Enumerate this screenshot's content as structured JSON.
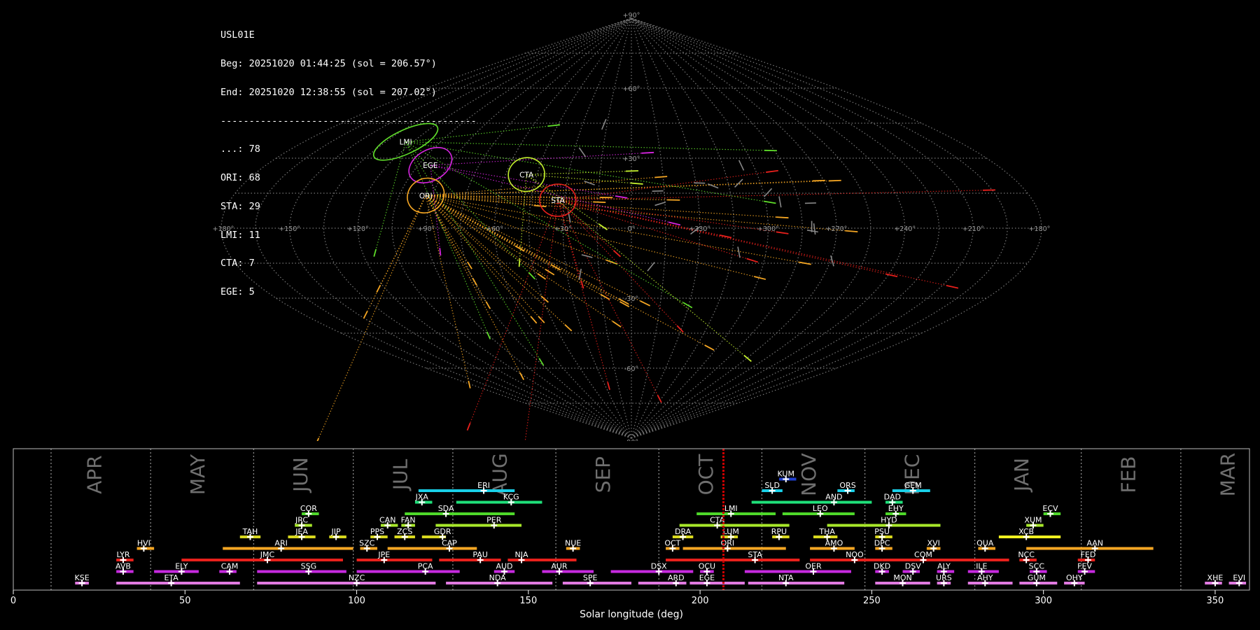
{
  "header": {
    "station": "USL01E",
    "begin": "Beg: 20251020 01:44:25 (sol = 206.57°)",
    "end": "End: 20251020 12:38:55 (sol = 207.02°)",
    "separator": "---------------------------------------------",
    "counts": [
      "...: 78",
      "ORI: 68",
      "STA: 29",
      "LMI: 11",
      "CTA: 7",
      "EGE: 5"
    ]
  },
  "colors": {
    "ORI": "#f5a623",
    "STA": "#e8201c",
    "LMI": "#5fdd2a",
    "EGE": "#d624e0",
    "CTA": "#c4f02e",
    "sporadic": "#888888",
    "grid": "#777777",
    "solarlon": "#cc0000"
  },
  "sky_map": {
    "projection": "sinusoidal (equal-area)",
    "meridian_labels": [
      "+180°",
      "+150°",
      "+120°",
      "+90°",
      "+60°",
      "+30°",
      "0°",
      "+330°",
      "+300°",
      "+270°",
      "+240°",
      "+210°",
      "+180°"
    ],
    "parallel_labels": [
      "+90°",
      "+60°",
      "+30°",
      "-30°",
      "-60°",
      "-90°"
    ],
    "radiants": [
      {
        "code": "LMI",
        "lon": 124,
        "lat": 37
      },
      {
        "code": "EGE",
        "lon": 99,
        "lat": 27
      },
      {
        "code": "ORI",
        "lon": 93,
        "lat": 14
      },
      {
        "code": "CTA",
        "lon": 50,
        "lat": 23
      },
      {
        "code": "STA",
        "lon": 33,
        "lat": 12
      }
    ]
  },
  "chart_data": {
    "type": "timeline",
    "xlabel": "Solar longitude (deg)",
    "xlim": [
      0,
      360
    ],
    "xticks": [
      0,
      50,
      100,
      150,
      200,
      250,
      300,
      350
    ],
    "current_sol": 206.8,
    "months": [
      {
        "name": "APR",
        "start": 11,
        "mid": 24
      },
      {
        "name": "MAY",
        "start": 40,
        "mid": 54
      },
      {
        "name": "JUN",
        "start": 70,
        "mid": 84
      },
      {
        "name": "JUL",
        "start": 99,
        "mid": 113
      },
      {
        "name": "AUG",
        "start": 128,
        "mid": 142
      },
      {
        "name": "SEP",
        "start": 158,
        "mid": 172
      },
      {
        "name": "OCT",
        "start": 188,
        "mid": 202
      },
      {
        "name": "NOV",
        "start": 218,
        "mid": 232
      },
      {
        "name": "DEC",
        "start": 248,
        "mid": 262
      },
      {
        "name": "JAN",
        "start": 280,
        "mid": 294
      },
      {
        "name": "FEB",
        "start": 311,
        "mid": 325
      },
      {
        "name": "MAR",
        "start": 340,
        "mid": 354
      }
    ],
    "showers": [
      {
        "code": "KUM",
        "row": 9,
        "start": 223,
        "end": 228,
        "peak": 225,
        "color": "#1f3fd0"
      },
      {
        "code": "ERI",
        "row": 8,
        "start": 118,
        "end": 146,
        "peak": 137,
        "color": "#19d0e8"
      },
      {
        "code": "SLD",
        "row": 8,
        "start": 218,
        "end": 224,
        "peak": 221,
        "color": "#19d0e8"
      },
      {
        "code": "ORS",
        "row": 8,
        "start": 240,
        "end": 245,
        "peak": 243,
        "color": "#19d0e8"
      },
      {
        "code": "GEM",
        "row": 8,
        "start": 256,
        "end": 267,
        "peak": 262,
        "color": "#19d0e8"
      },
      {
        "code": "JXA",
        "row": 7,
        "start": 117,
        "end": 122,
        "peak": 119,
        "color": "#1fe07a"
      },
      {
        "code": "KCG",
        "row": 7,
        "start": 129,
        "end": 154,
        "peak": 145,
        "color": "#1fe07a"
      },
      {
        "code": "AND",
        "row": 7,
        "start": 215,
        "end": 250,
        "peak": 239,
        "color": "#1fe07a"
      },
      {
        "code": "DAD",
        "row": 7,
        "start": 254,
        "end": 259,
        "peak": 256,
        "color": "#1fe07a"
      },
      {
        "code": "COR",
        "row": 6,
        "start": 84,
        "end": 89,
        "peak": 86,
        "color": "#4ed82a"
      },
      {
        "code": "SDA",
        "row": 6,
        "start": 114,
        "end": 146,
        "peak": 126,
        "color": "#4ed82a"
      },
      {
        "code": "LMI",
        "row": 6,
        "start": 199,
        "end": 222,
        "peak": 209,
        "color": "#4ed82a"
      },
      {
        "code": "LEO",
        "row": 6,
        "start": 224,
        "end": 245,
        "peak": 235,
        "color": "#4ed82a"
      },
      {
        "code": "EHY",
        "row": 6,
        "start": 254,
        "end": 260,
        "peak": 257,
        "color": "#4ed82a"
      },
      {
        "code": "ECV",
        "row": 6,
        "start": 300,
        "end": 305,
        "peak": 302,
        "color": "#4ed82a"
      },
      {
        "code": "JRC",
        "row": 5,
        "start": 82,
        "end": 87,
        "peak": 84,
        "color": "#a8e82a"
      },
      {
        "code": "CAN",
        "row": 5,
        "start": 107,
        "end": 112,
        "peak": 109,
        "color": "#a8e82a"
      },
      {
        "code": "FAN",
        "row": 5,
        "start": 113,
        "end": 117,
        "peak": 115,
        "color": "#a8e82a"
      },
      {
        "code": "PER",
        "row": 5,
        "start": 123,
        "end": 148,
        "peak": 140,
        "color": "#a8e82a"
      },
      {
        "code": "CTA",
        "row": 5,
        "start": 194,
        "end": 226,
        "peak": 205,
        "color": "#a8e82a"
      },
      {
        "code": "HYD",
        "row": 5,
        "start": 237,
        "end": 270,
        "peak": 255,
        "color": "#a8e82a"
      },
      {
        "code": "XUM",
        "row": 5,
        "start": 295,
        "end": 300,
        "peak": 297,
        "color": "#a8e82a"
      },
      {
        "code": "TAH",
        "row": 4,
        "start": 66,
        "end": 72,
        "peak": 69,
        "color": "#d8d81e"
      },
      {
        "code": "JEA",
        "row": 4,
        "start": 80,
        "end": 88,
        "peak": 84,
        "color": "#d8d81e"
      },
      {
        "code": "JIP",
        "row": 4,
        "start": 92,
        "end": 97,
        "peak": 94,
        "color": "#d8d81e"
      },
      {
        "code": "PPS",
        "row": 4,
        "start": 104,
        "end": 109,
        "peak": 106,
        "color": "#d8d81e"
      },
      {
        "code": "ZCS",
        "row": 4,
        "start": 111,
        "end": 117,
        "peak": 114,
        "color": "#d8d81e"
      },
      {
        "code": "GDR",
        "row": 4,
        "start": 119,
        "end": 126,
        "peak": 125,
        "color": "#d8d81e"
      },
      {
        "code": "DRA",
        "row": 4,
        "start": 192,
        "end": 198,
        "peak": 195,
        "color": "#d8d81e"
      },
      {
        "code": "LUM",
        "row": 4,
        "start": 206,
        "end": 211,
        "peak": 209,
        "color": "#d8d81e"
      },
      {
        "code": "RPU",
        "row": 4,
        "start": 221,
        "end": 226,
        "peak": 223,
        "color": "#d8d81e"
      },
      {
        "code": "THA",
        "row": 4,
        "start": 233,
        "end": 240,
        "peak": 237,
        "color": "#d8d81e"
      },
      {
        "code": "PSU",
        "row": 4,
        "start": 251,
        "end": 256,
        "peak": 253,
        "color": "#d8d81e"
      },
      {
        "code": "XCB",
        "row": 4,
        "start": 287,
        "end": 305,
        "peak": 295,
        "color": "#f0f020"
      },
      {
        "code": "HVI",
        "row": 3,
        "start": 36,
        "end": 41,
        "peak": 38,
        "color": "#f5a623"
      },
      {
        "code": "ARI",
        "row": 3,
        "start": 61,
        "end": 99,
        "peak": 78,
        "color": "#f5a623"
      },
      {
        "code": "SZC",
        "row": 3,
        "start": 101,
        "end": 106,
        "peak": 103,
        "color": "#f5a623"
      },
      {
        "code": "CAP",
        "row": 3,
        "start": 109,
        "end": 135,
        "peak": 127,
        "color": "#f5a623"
      },
      {
        "code": "NUE",
        "row": 3,
        "start": 161,
        "end": 165,
        "peak": 163,
        "color": "#f5a623"
      },
      {
        "code": "OCT",
        "row": 3,
        "start": 190,
        "end": 194,
        "peak": 192,
        "color": "#f5a623"
      },
      {
        "code": "ORI",
        "row": 3,
        "start": 195,
        "end": 225,
        "peak": 208,
        "color": "#f5a623"
      },
      {
        "code": "AMO",
        "row": 3,
        "start": 232,
        "end": 245,
        "peak": 239,
        "color": "#f5a623"
      },
      {
        "code": "DPC",
        "row": 3,
        "start": 251,
        "end": 256,
        "peak": 253,
        "color": "#f5a623"
      },
      {
        "code": "XVI",
        "row": 3,
        "start": 266,
        "end": 270,
        "peak": 268,
        "color": "#f5a623"
      },
      {
        "code": "QUA",
        "row": 3,
        "start": 281,
        "end": 286,
        "peak": 283,
        "color": "#f5a623"
      },
      {
        "code": "AAN",
        "row": 3,
        "start": 295,
        "end": 332,
        "peak": 315,
        "color": "#f5a623"
      },
      {
        "code": "LYR",
        "row": 2,
        "start": 30,
        "end": 35,
        "peak": 32,
        "color": "#e8201c"
      },
      {
        "code": "JMC",
        "row": 2,
        "start": 49,
        "end": 96,
        "peak": 74,
        "color": "#e8201c"
      },
      {
        "code": "JPE",
        "row": 2,
        "start": 100,
        "end": 122,
        "peak": 108,
        "color": "#e8201c"
      },
      {
        "code": "PAU",
        "row": 2,
        "start": 124,
        "end": 142,
        "peak": 136,
        "color": "#e8201c"
      },
      {
        "code": "NIA",
        "row": 2,
        "start": 144,
        "end": 164,
        "peak": 148,
        "color": "#e8201c"
      },
      {
        "code": "STA",
        "row": 2,
        "start": 190,
        "end": 229,
        "peak": 216,
        "color": "#e8201c"
      },
      {
        "code": "NOO",
        "row": 2,
        "start": 232,
        "end": 253,
        "peak": 245,
        "color": "#e8201c"
      },
      {
        "code": "COM",
        "row": 2,
        "start": 253,
        "end": 290,
        "peak": 265,
        "color": "#e8201c"
      },
      {
        "code": "NCC",
        "row": 2,
        "start": 293,
        "end": 298,
        "peak": 295,
        "color": "#e8201c"
      },
      {
        "code": "FED",
        "row": 2,
        "start": 310,
        "end": 315,
        "peak": 313,
        "color": "#e8201c"
      },
      {
        "code": "AVB",
        "row": 1,
        "start": 30,
        "end": 35,
        "peak": 32,
        "color": "#c72ae0"
      },
      {
        "code": "ELY",
        "row": 1,
        "start": 41,
        "end": 54,
        "peak": 49,
        "color": "#c72ae0"
      },
      {
        "code": "CAM",
        "row": 1,
        "start": 60,
        "end": 65,
        "peak": 63,
        "color": "#c72ae0"
      },
      {
        "code": "SSG",
        "row": 1,
        "start": 71,
        "end": 97,
        "peak": 86,
        "color": "#c72ae0"
      },
      {
        "code": "PCA",
        "row": 1,
        "start": 100,
        "end": 130,
        "peak": 120,
        "color": "#c72ae0"
      },
      {
        "code": "AUD",
        "row": 1,
        "start": 140,
        "end": 146,
        "peak": 143,
        "color": "#c72ae0"
      },
      {
        "code": "AUR",
        "row": 1,
        "start": 154,
        "end": 169,
        "peak": 159,
        "color": "#c72ae0"
      },
      {
        "code": "DSX",
        "row": 1,
        "start": 174,
        "end": 198,
        "peak": 188,
        "color": "#c72ae0"
      },
      {
        "code": "OCU",
        "row": 1,
        "start": 200,
        "end": 204,
        "peak": 202,
        "color": "#c72ae0"
      },
      {
        "code": "OER",
        "row": 1,
        "start": 213,
        "end": 244,
        "peak": 233,
        "color": "#c72ae0"
      },
      {
        "code": "DKD",
        "row": 1,
        "start": 251,
        "end": 255,
        "peak": 253,
        "color": "#c72ae0"
      },
      {
        "code": "DSV",
        "row": 1,
        "start": 259,
        "end": 264,
        "peak": 262,
        "color": "#c72ae0"
      },
      {
        "code": "ALY",
        "row": 1,
        "start": 269,
        "end": 274,
        "peak": 271,
        "color": "#c72ae0"
      },
      {
        "code": "ILE",
        "row": 1,
        "start": 278,
        "end": 287,
        "peak": 282,
        "color": "#c72ae0"
      },
      {
        "code": "SCC",
        "row": 1,
        "start": 296,
        "end": 301,
        "peak": 298,
        "color": "#c72ae0"
      },
      {
        "code": "FEV",
        "row": 1,
        "start": 310,
        "end": 315,
        "peak": 312,
        "color": "#c72ae0"
      },
      {
        "code": "KSE",
        "row": 0,
        "start": 18,
        "end": 22,
        "peak": 20,
        "color": "#e07ae0"
      },
      {
        "code": "ETA",
        "row": 0,
        "start": 30,
        "end": 66,
        "peak": 46,
        "color": "#e07ae0"
      },
      {
        "code": "NZC",
        "row": 0,
        "start": 71,
        "end": 123,
        "peak": 100,
        "color": "#e07ae0"
      },
      {
        "code": "NDA",
        "row": 0,
        "start": 126,
        "end": 157,
        "peak": 141,
        "color": "#e07ae0"
      },
      {
        "code": "SPE",
        "row": 0,
        "start": 160,
        "end": 180,
        "peak": 168,
        "color": "#e07ae0"
      },
      {
        "code": "ARD",
        "row": 0,
        "start": 182,
        "end": 196,
        "peak": 193,
        "color": "#e07ae0"
      },
      {
        "code": "EGE",
        "row": 0,
        "start": 197,
        "end": 213,
        "peak": 202,
        "color": "#e07ae0"
      },
      {
        "code": "NTA",
        "row": 0,
        "start": 214,
        "end": 242,
        "peak": 225,
        "color": "#e07ae0"
      },
      {
        "code": "MON",
        "row": 0,
        "start": 251,
        "end": 267,
        "peak": 259,
        "color": "#e07ae0"
      },
      {
        "code": "URS",
        "row": 0,
        "start": 269,
        "end": 273,
        "peak": 271,
        "color": "#e07ae0"
      },
      {
        "code": "AHY",
        "row": 0,
        "start": 278,
        "end": 291,
        "peak": 283,
        "color": "#e07ae0"
      },
      {
        "code": "GUM",
        "row": 0,
        "start": 293,
        "end": 304,
        "peak": 298,
        "color": "#e07ae0"
      },
      {
        "code": "OHY",
        "row": 0,
        "start": 306,
        "end": 312,
        "peak": 309,
        "color": "#e07ae0"
      },
      {
        "code": "XHE",
        "row": 0,
        "start": 347,
        "end": 352,
        "peak": 350,
        "color": "#e07ae0"
      },
      {
        "code": "EVI",
        "row": 0,
        "start": 354,
        "end": 359,
        "peak": 357,
        "color": "#e07ae0"
      }
    ]
  }
}
